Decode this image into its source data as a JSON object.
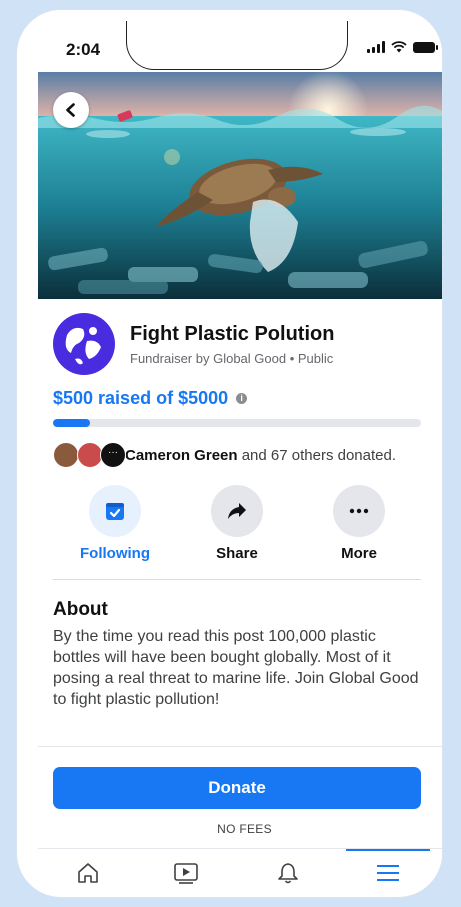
{
  "status_bar": {
    "time": "2:04"
  },
  "fundraiser": {
    "title": "Fight Plastic Polution",
    "subtitle": "Fundraiser by Global Good • Public",
    "raised_text": "$500 raised of $5000",
    "progress_fraction": 0.1
  },
  "donors": {
    "name": "Cameron Green",
    "rest": " and 67 others donated."
  },
  "actions": [
    {
      "label": "Following",
      "icon": "calendar-check-icon",
      "active": true
    },
    {
      "label": "Share",
      "icon": "share-arrow-icon",
      "active": false
    },
    {
      "label": "More",
      "icon": "more-dots-icon",
      "active": false
    }
  ],
  "about": {
    "title": "About",
    "body": "By the time you read this post 100,000 plastic bottles will have been bought globally. Most of it posing a real threat to marine life. Join Global Good to fight plastic pollution!"
  },
  "donate": {
    "label": "Donate",
    "note": "NO FEES"
  },
  "tabbar": {
    "items": [
      "home-icon",
      "video-icon",
      "bell-icon",
      "menu-icon"
    ],
    "active": "menu-icon"
  },
  "colors": {
    "accent": "#1877f2",
    "logo_bg": "#4a2ce0",
    "page_bg": "#cfe2f6"
  }
}
